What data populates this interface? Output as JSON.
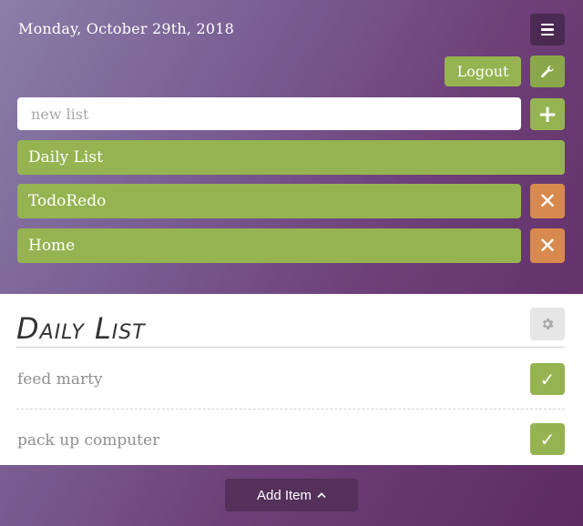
{
  "header": {
    "date": "Monday, October 29th, 2018",
    "menu_icon": "hamburger-menu-icon"
  },
  "account": {
    "logout_label": "Logout",
    "settings_icon": "wrench-icon"
  },
  "new_list": {
    "placeholder": "new list",
    "value": "",
    "add_icon": "plus-icon",
    "add_glyph": "+"
  },
  "lists": [
    {
      "label": "Daily List",
      "deletable": false
    },
    {
      "label": "TodoRedo",
      "deletable": true,
      "delete_glyph": "✕"
    },
    {
      "label": "Home",
      "deletable": true,
      "delete_glyph": "✕"
    }
  ],
  "active_list": {
    "title": "Daily List",
    "settings_icon": "gear-icon",
    "items": [
      {
        "text": "feed marty",
        "check_glyph": "✓"
      },
      {
        "text": "pack up computer",
        "check_glyph": "✓"
      }
    ]
  },
  "footer": {
    "add_item_label": "Add Item",
    "chevron_icon": "chevron-up-icon"
  },
  "colors": {
    "green": "#95b451",
    "orange": "#d88a4e",
    "dark_purple": "#4a2a52"
  }
}
